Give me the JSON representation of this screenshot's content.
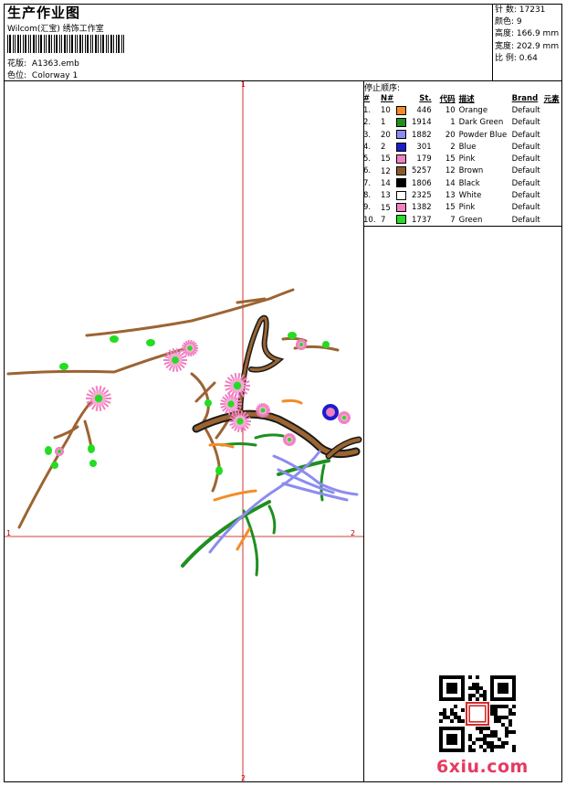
{
  "header": {
    "title": "生产作业图",
    "subtitle": "Wilcom(汇宝) 绣饰工作室",
    "design_label": "花版:",
    "design_value": "A1363.emb",
    "colorway_label": "色位:",
    "colorway_value": "Colorway 1"
  },
  "stats": [
    {
      "label": "针 数:",
      "value": "17231"
    },
    {
      "label": "颜色:",
      "value": "9"
    },
    {
      "label": "高度:",
      "value": "166.9 mm"
    },
    {
      "label": "宽度:",
      "value": "202.9 mm"
    },
    {
      "label": "比 例:",
      "value": "0.64"
    }
  ],
  "stop_sequence_label": "停止顺序:",
  "table": {
    "headers": [
      "#",
      "N#",
      "St.",
      "代码",
      "描述",
      "Brand",
      "元素"
    ],
    "rows": [
      {
        "idx": "1.",
        "n": "10",
        "color": "#f28c28",
        "st": "446",
        "code": "10",
        "desc": "Orange",
        "brand": "Default"
      },
      {
        "idx": "2.",
        "n": "1",
        "color": "#1f8f1f",
        "st": "1914",
        "code": "1",
        "desc": "Dark Green",
        "brand": "Default"
      },
      {
        "idx": "3.",
        "n": "20",
        "color": "#8c8cf0",
        "st": "1882",
        "code": "20",
        "desc": "Powder Blue",
        "brand": "Default"
      },
      {
        "idx": "4.",
        "n": "2",
        "color": "#1c1ccc",
        "st": "301",
        "code": "2",
        "desc": "Blue",
        "brand": "Default"
      },
      {
        "idx": "5.",
        "n": "15",
        "color": "#f080c0",
        "st": "179",
        "code": "15",
        "desc": "Pink",
        "brand": "Default"
      },
      {
        "idx": "6.",
        "n": "12",
        "color": "#8b5a2b",
        "st": "5257",
        "code": "12",
        "desc": "Brown",
        "brand": "Default"
      },
      {
        "idx": "7.",
        "n": "14",
        "color": "#000000",
        "st": "1806",
        "code": "14",
        "desc": "Black",
        "brand": "Default"
      },
      {
        "idx": "8.",
        "n": "13",
        "color": "#ffffff",
        "st": "2325",
        "code": "13",
        "desc": "White",
        "brand": "Default"
      },
      {
        "idx": "9.",
        "n": "15",
        "color": "#f080c0",
        "st": "1382",
        "code": "15",
        "desc": "Pink",
        "brand": "Default"
      },
      {
        "idx": "10.",
        "n": "7",
        "color": "#22dd22",
        "st": "1737",
        "code": "7",
        "desc": "Green",
        "brand": "Default"
      }
    ]
  },
  "markers": {
    "top": "1",
    "bottom": "2",
    "left": "1",
    "right": "2"
  },
  "watermark": {
    "logo": "6xiu.com"
  }
}
